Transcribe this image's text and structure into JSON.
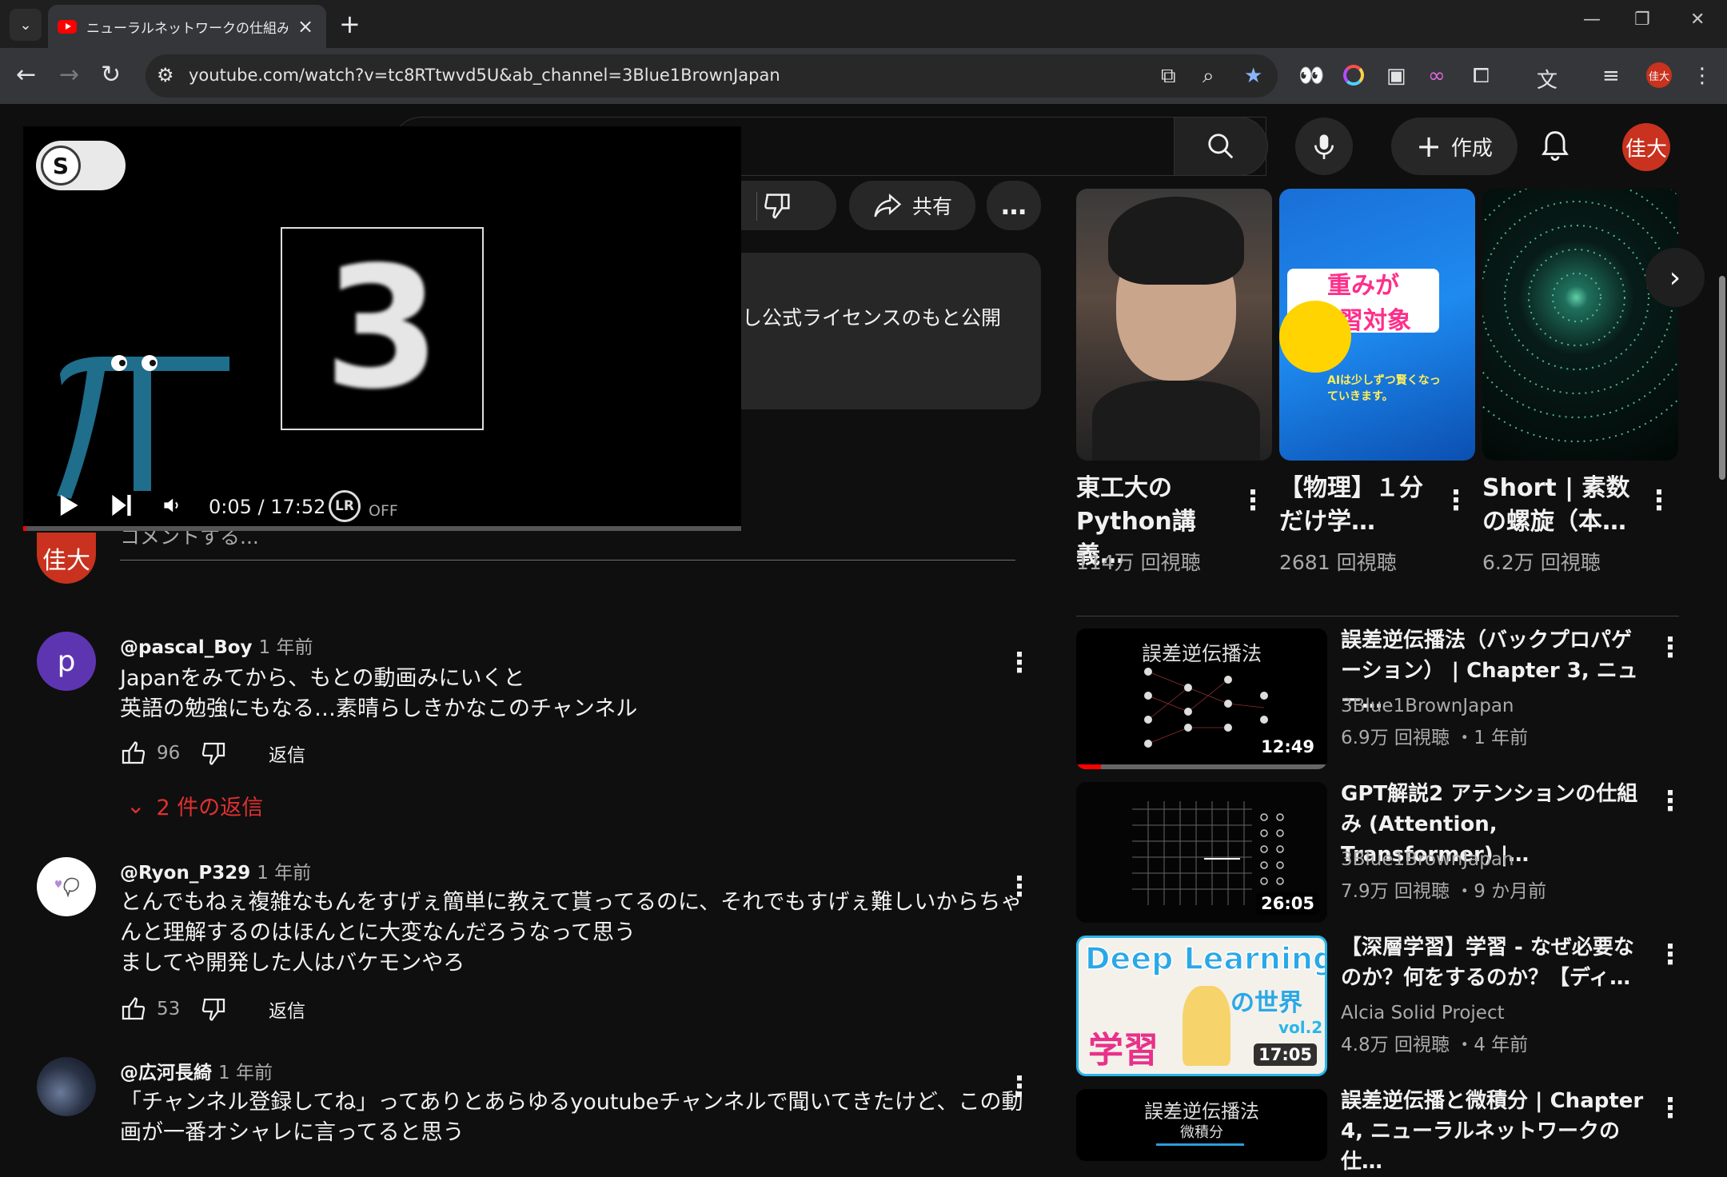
{
  "browser": {
    "tab_title": "ニューラルネットワークの仕組み | Cha",
    "new_tab": "+",
    "url": "youtube.com/watch?v=tc8RTtwvd5U&ab_channel=3Blue1BrownJapan",
    "profile_initials": "佳大"
  },
  "header": {
    "create_label": "作成",
    "avatar_initials": "佳大"
  },
  "actions": {
    "share_label": "共有",
    "more_label": "…"
  },
  "description": {
    "text_fragment": "し公式ライセンスのもと公開"
  },
  "player": {
    "digit": "3",
    "toggle_letter": "S",
    "time": "0:05 / 17:52",
    "lr_label": "LR",
    "lr_state": "OFF",
    "progress": 0.005
  },
  "comment_box": {
    "avatar_initials": "佳大",
    "placeholder": "コメントする..."
  },
  "comments": [
    {
      "avatar_letter": "p",
      "avatar_color": "#5e35b1",
      "author": "@pascal_Boy",
      "time": "1 年前",
      "body": "Japanをみてから、もとの動画みにいくと\n英語の勉強にもなる…素晴らしきかなこのチャンネル",
      "likes": "96",
      "reply_label": "返信",
      "replies_label": "2 件の返信"
    },
    {
      "avatar_letter": "",
      "avatar_color": "#ffffff",
      "author": "@Ryon_P329",
      "time": "1 年前",
      "body": "とんでもねぇ複雑なもんをすげぇ簡単に教えて貰ってるのに、それでもすげぇ難しいからちゃんと理解するのはほんとに大変なんだろうなって思う\nましてや開発した人はバケモンやろ",
      "likes": "53",
      "reply_label": "返信"
    },
    {
      "avatar_letter": "",
      "avatar_color": "#2a3346",
      "author": "@広河長綺",
      "time": "1 年前",
      "body": "「チャンネル登録してね」ってありとあらゆるyoutubeチャンネルで聞いてきたけど、この動画が一番オシャレに言ってると思う"
    }
  ],
  "shorts": [
    {
      "title": "東工大のPython講義…",
      "views": "114万 回視聴"
    },
    {
      "title": "【物理】１分だけ学…",
      "views": "2681 回視聴",
      "thumb_text_1": "重みが",
      "thumb_text_2": "学習対象",
      "thumb_caption": "AIは少しずつ賢くなっていきます。"
    },
    {
      "title": "Short | 素数の螺旋（本…",
      "views": "6.2万 回視聴"
    }
  ],
  "related": [
    {
      "title": "誤差逆伝播法（バックプロパゲーション） | Chapter 3, ニュー…",
      "channel": "3Blue1BrownJapan",
      "meta": "6.9万 回視聴 ・1 年前",
      "duration": "12:49",
      "thumb_text": "誤差逆伝播法",
      "watched": 0.1
    },
    {
      "title": "GPT解説2 アテンションの仕組み (Attention, Transformer) |…",
      "channel": "3Blue1BrownJapan",
      "meta": "7.9万 回視聴 ・9 か月前",
      "duration": "26:05"
    },
    {
      "title": "【深層学習】学習 - なぜ必要なのか？何をするのか？【ディ…",
      "channel": "Alcia Solid Project",
      "meta": "4.8万 回視聴 ・4 年前",
      "duration": "17:05",
      "thumb_text_1": "Deep Learning",
      "thumb_text_2": "の世界",
      "thumb_text_3": "学習",
      "thumb_vol": "vol.2"
    },
    {
      "title": "誤差逆伝播と微積分 | Chapter 4, ニューラルネットワークの仕…",
      "thumb_text": "誤差逆伝播法",
      "thumb_sub": "微積分"
    }
  ],
  "colors": {
    "background": "#0f0f0f",
    "accent_red": "#ff0000",
    "avatar": "#c8321e",
    "replies_link": "#e03030"
  }
}
